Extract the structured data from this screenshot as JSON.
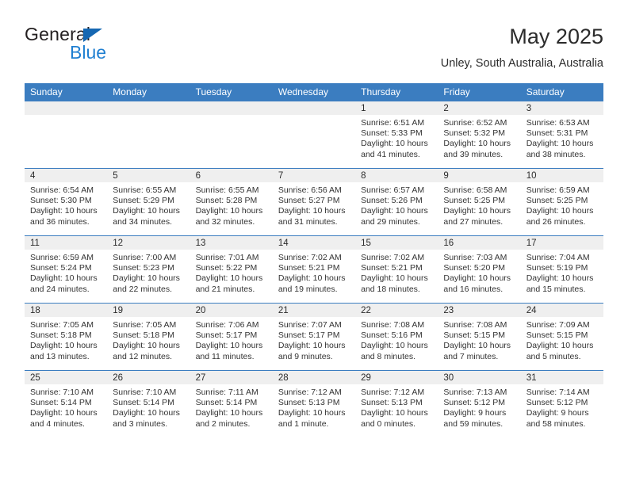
{
  "brand": {
    "word_one": "General",
    "word_two": "Blue",
    "triangle_color": "#1567b2",
    "blue_color": "#1f7fd1"
  },
  "header": {
    "title": "May 2025",
    "subtitle": "Unley, South Australia, Australia",
    "header_bg": "#3b7dc0",
    "daynum_bg": "#efefef"
  },
  "weekday_headers": [
    "Sunday",
    "Monday",
    "Tuesday",
    "Wednesday",
    "Thursday",
    "Friday",
    "Saturday"
  ],
  "weeks": [
    [
      {
        "day": "",
        "sunrise": "",
        "sunset": "",
        "daylight1": "",
        "daylight2": ""
      },
      {
        "day": "",
        "sunrise": "",
        "sunset": "",
        "daylight1": "",
        "daylight2": ""
      },
      {
        "day": "",
        "sunrise": "",
        "sunset": "",
        "daylight1": "",
        "daylight2": ""
      },
      {
        "day": "",
        "sunrise": "",
        "sunset": "",
        "daylight1": "",
        "daylight2": ""
      },
      {
        "day": "1",
        "sunrise": "Sunrise: 6:51 AM",
        "sunset": "Sunset: 5:33 PM",
        "daylight1": "Daylight: 10 hours",
        "daylight2": "and 41 minutes."
      },
      {
        "day": "2",
        "sunrise": "Sunrise: 6:52 AM",
        "sunset": "Sunset: 5:32 PM",
        "daylight1": "Daylight: 10 hours",
        "daylight2": "and 39 minutes."
      },
      {
        "day": "3",
        "sunrise": "Sunrise: 6:53 AM",
        "sunset": "Sunset: 5:31 PM",
        "daylight1": "Daylight: 10 hours",
        "daylight2": "and 38 minutes."
      }
    ],
    [
      {
        "day": "4",
        "sunrise": "Sunrise: 6:54 AM",
        "sunset": "Sunset: 5:30 PM",
        "daylight1": "Daylight: 10 hours",
        "daylight2": "and 36 minutes."
      },
      {
        "day": "5",
        "sunrise": "Sunrise: 6:55 AM",
        "sunset": "Sunset: 5:29 PM",
        "daylight1": "Daylight: 10 hours",
        "daylight2": "and 34 minutes."
      },
      {
        "day": "6",
        "sunrise": "Sunrise: 6:55 AM",
        "sunset": "Sunset: 5:28 PM",
        "daylight1": "Daylight: 10 hours",
        "daylight2": "and 32 minutes."
      },
      {
        "day": "7",
        "sunrise": "Sunrise: 6:56 AM",
        "sunset": "Sunset: 5:27 PM",
        "daylight1": "Daylight: 10 hours",
        "daylight2": "and 31 minutes."
      },
      {
        "day": "8",
        "sunrise": "Sunrise: 6:57 AM",
        "sunset": "Sunset: 5:26 PM",
        "daylight1": "Daylight: 10 hours",
        "daylight2": "and 29 minutes."
      },
      {
        "day": "9",
        "sunrise": "Sunrise: 6:58 AM",
        "sunset": "Sunset: 5:25 PM",
        "daylight1": "Daylight: 10 hours",
        "daylight2": "and 27 minutes."
      },
      {
        "day": "10",
        "sunrise": "Sunrise: 6:59 AM",
        "sunset": "Sunset: 5:25 PM",
        "daylight1": "Daylight: 10 hours",
        "daylight2": "and 26 minutes."
      }
    ],
    [
      {
        "day": "11",
        "sunrise": "Sunrise: 6:59 AM",
        "sunset": "Sunset: 5:24 PM",
        "daylight1": "Daylight: 10 hours",
        "daylight2": "and 24 minutes."
      },
      {
        "day": "12",
        "sunrise": "Sunrise: 7:00 AM",
        "sunset": "Sunset: 5:23 PM",
        "daylight1": "Daylight: 10 hours",
        "daylight2": "and 22 minutes."
      },
      {
        "day": "13",
        "sunrise": "Sunrise: 7:01 AM",
        "sunset": "Sunset: 5:22 PM",
        "daylight1": "Daylight: 10 hours",
        "daylight2": "and 21 minutes."
      },
      {
        "day": "14",
        "sunrise": "Sunrise: 7:02 AM",
        "sunset": "Sunset: 5:21 PM",
        "daylight1": "Daylight: 10 hours",
        "daylight2": "and 19 minutes."
      },
      {
        "day": "15",
        "sunrise": "Sunrise: 7:02 AM",
        "sunset": "Sunset: 5:21 PM",
        "daylight1": "Daylight: 10 hours",
        "daylight2": "and 18 minutes."
      },
      {
        "day": "16",
        "sunrise": "Sunrise: 7:03 AM",
        "sunset": "Sunset: 5:20 PM",
        "daylight1": "Daylight: 10 hours",
        "daylight2": "and 16 minutes."
      },
      {
        "day": "17",
        "sunrise": "Sunrise: 7:04 AM",
        "sunset": "Sunset: 5:19 PM",
        "daylight1": "Daylight: 10 hours",
        "daylight2": "and 15 minutes."
      }
    ],
    [
      {
        "day": "18",
        "sunrise": "Sunrise: 7:05 AM",
        "sunset": "Sunset: 5:18 PM",
        "daylight1": "Daylight: 10 hours",
        "daylight2": "and 13 minutes."
      },
      {
        "day": "19",
        "sunrise": "Sunrise: 7:05 AM",
        "sunset": "Sunset: 5:18 PM",
        "daylight1": "Daylight: 10 hours",
        "daylight2": "and 12 minutes."
      },
      {
        "day": "20",
        "sunrise": "Sunrise: 7:06 AM",
        "sunset": "Sunset: 5:17 PM",
        "daylight1": "Daylight: 10 hours",
        "daylight2": "and 11 minutes."
      },
      {
        "day": "21",
        "sunrise": "Sunrise: 7:07 AM",
        "sunset": "Sunset: 5:17 PM",
        "daylight1": "Daylight: 10 hours",
        "daylight2": "and 9 minutes."
      },
      {
        "day": "22",
        "sunrise": "Sunrise: 7:08 AM",
        "sunset": "Sunset: 5:16 PM",
        "daylight1": "Daylight: 10 hours",
        "daylight2": "and 8 minutes."
      },
      {
        "day": "23",
        "sunrise": "Sunrise: 7:08 AM",
        "sunset": "Sunset: 5:15 PM",
        "daylight1": "Daylight: 10 hours",
        "daylight2": "and 7 minutes."
      },
      {
        "day": "24",
        "sunrise": "Sunrise: 7:09 AM",
        "sunset": "Sunset: 5:15 PM",
        "daylight1": "Daylight: 10 hours",
        "daylight2": "and 5 minutes."
      }
    ],
    [
      {
        "day": "25",
        "sunrise": "Sunrise: 7:10 AM",
        "sunset": "Sunset: 5:14 PM",
        "daylight1": "Daylight: 10 hours",
        "daylight2": "and 4 minutes."
      },
      {
        "day": "26",
        "sunrise": "Sunrise: 7:10 AM",
        "sunset": "Sunset: 5:14 PM",
        "daylight1": "Daylight: 10 hours",
        "daylight2": "and 3 minutes."
      },
      {
        "day": "27",
        "sunrise": "Sunrise: 7:11 AM",
        "sunset": "Sunset: 5:14 PM",
        "daylight1": "Daylight: 10 hours",
        "daylight2": "and 2 minutes."
      },
      {
        "day": "28",
        "sunrise": "Sunrise: 7:12 AM",
        "sunset": "Sunset: 5:13 PM",
        "daylight1": "Daylight: 10 hours",
        "daylight2": "and 1 minute."
      },
      {
        "day": "29",
        "sunrise": "Sunrise: 7:12 AM",
        "sunset": "Sunset: 5:13 PM",
        "daylight1": "Daylight: 10 hours",
        "daylight2": "and 0 minutes."
      },
      {
        "day": "30",
        "sunrise": "Sunrise: 7:13 AM",
        "sunset": "Sunset: 5:12 PM",
        "daylight1": "Daylight: 9 hours",
        "daylight2": "and 59 minutes."
      },
      {
        "day": "31",
        "sunrise": "Sunrise: 7:14 AM",
        "sunset": "Sunset: 5:12 PM",
        "daylight1": "Daylight: 9 hours",
        "daylight2": "and 58 minutes."
      }
    ]
  ]
}
